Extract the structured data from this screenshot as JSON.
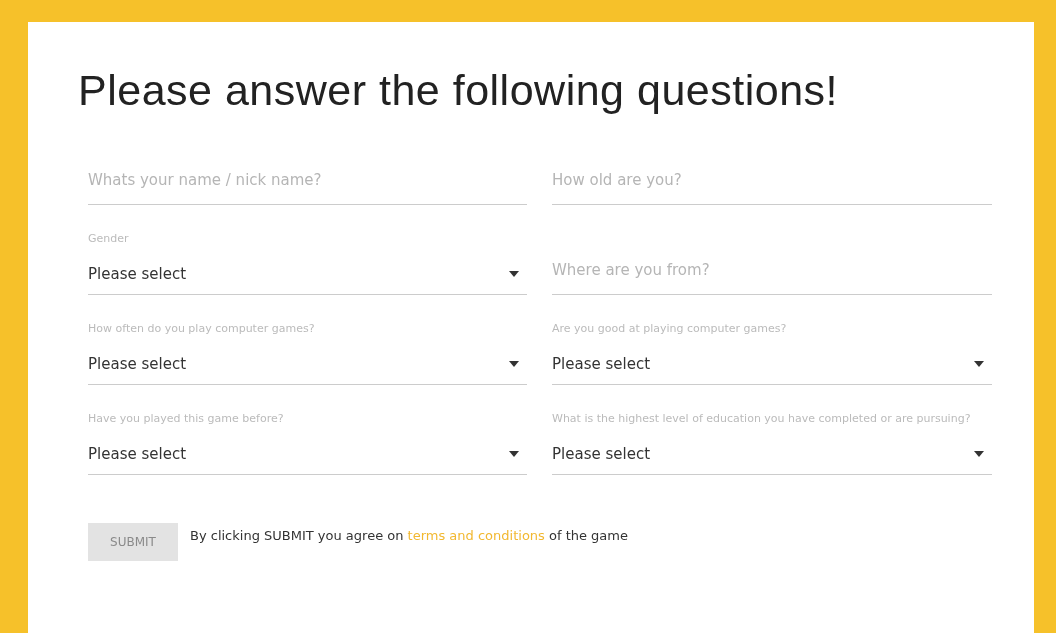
{
  "title": "Please answer the following questions!",
  "fields": [
    {
      "kind": "text",
      "placeholder": "Whats your name / nick name?"
    },
    {
      "kind": "text",
      "placeholder": "How old are you?"
    },
    {
      "kind": "select",
      "label": "Gender",
      "value": "Please select"
    },
    {
      "kind": "text",
      "placeholder": "Where are you from?"
    },
    {
      "kind": "select",
      "label": "How often do you play computer games?",
      "value": "Please select"
    },
    {
      "kind": "select",
      "label": "Are you good at playing computer games?",
      "value": "Please select"
    },
    {
      "kind": "select",
      "label": "Have you played this game before?",
      "value": "Please select"
    },
    {
      "kind": "select",
      "label": "What is the highest level of education you have completed or are pursuing?",
      "value": "Please select"
    }
  ],
  "submit": {
    "label": "SUBMIT",
    "disabled": true
  },
  "agreement": {
    "before": "By clicking SUBMIT you agree on",
    "link": "terms and conditions",
    "after": "of the game"
  }
}
